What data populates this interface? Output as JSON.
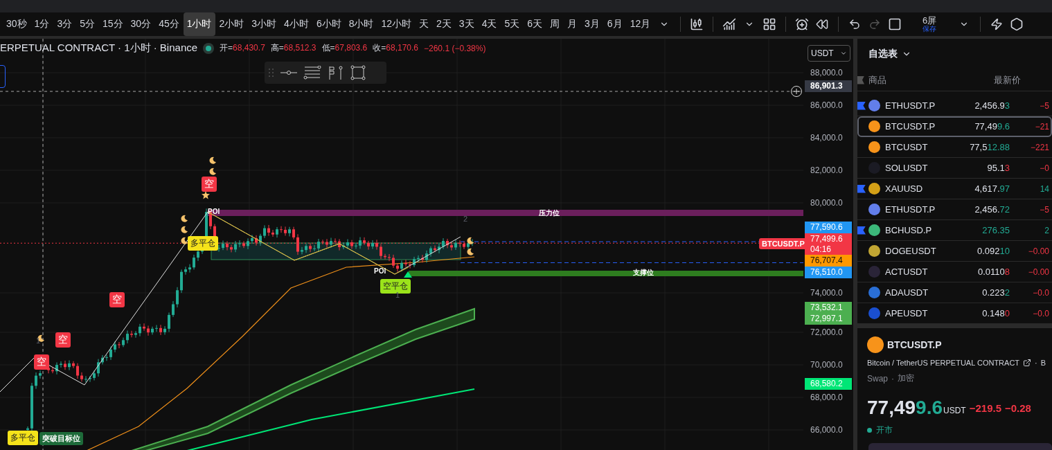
{
  "timeframes": [
    {
      "label": "30秒",
      "selected": false
    },
    {
      "label": "1分",
      "selected": false
    },
    {
      "label": "3分",
      "selected": false
    },
    {
      "label": "5分",
      "selected": false
    },
    {
      "label": "15分",
      "selected": false
    },
    {
      "label": "30分",
      "selected": false
    },
    {
      "label": "45分",
      "selected": false
    },
    {
      "label": "1小时",
      "selected": true
    },
    {
      "label": "2小时",
      "selected": false
    },
    {
      "label": "3小时",
      "selected": false
    },
    {
      "label": "4小时",
      "selected": false
    },
    {
      "label": "6小时",
      "selected": false
    },
    {
      "label": "8小时",
      "selected": false
    },
    {
      "label": "12小时",
      "selected": false
    },
    {
      "label": "天",
      "selected": false
    },
    {
      "label": "2天",
      "selected": false
    },
    {
      "label": "3天",
      "selected": false
    },
    {
      "label": "4天",
      "selected": false
    },
    {
      "label": "5天",
      "selected": false
    },
    {
      "label": "6天",
      "selected": false
    },
    {
      "label": "周",
      "selected": false
    },
    {
      "label": "月",
      "selected": false
    },
    {
      "label": "3月",
      "selected": false
    },
    {
      "label": "6月",
      "selected": false
    },
    {
      "label": "12月",
      "selected": false
    }
  ],
  "history": {
    "undo_disabled": false,
    "redo_disabled": true
  },
  "layout_button": {
    "label": "6屏",
    "sublabel": "保存"
  },
  "chart": {
    "title": "ERPETUAL CONTRACT · 1小时 · Binance",
    "ohlc": [
      {
        "label": "开=",
        "value": "68,430.7"
      },
      {
        "label": "高=",
        "value": "68,512.3"
      },
      {
        "label": "低=",
        "value": "67,803.6"
      },
      {
        "label": "收=",
        "value": "68,170.6"
      }
    ],
    "change": "−260.1 (−0.38%)",
    "currency": "USDT",
    "price_ticks": [
      "88,000.0",
      "86,000.0",
      "84,000.0",
      "82,000.0",
      "80,000.0",
      "74,000.0",
      "72,000.0",
      "70,000.0",
      "68,000.0",
      "66,000.0"
    ],
    "price_tags": [
      {
        "value": "86,901.3",
        "color": "#363a45"
      },
      {
        "value": "77,590.6",
        "color": "#2196f3"
      },
      {
        "value": "77,499.6",
        "sub": "04:16",
        "color": "#f23645"
      },
      {
        "value": "76,707.4",
        "color": "#ff9800"
      },
      {
        "value": "76,510.0",
        "color": "#2196f3"
      },
      {
        "value": "73,532.1",
        "color": "#4caf50"
      },
      {
        "value": "72,997.1",
        "color": "#4caf50"
      },
      {
        "value": "68,580.2",
        "color": "#00e676"
      }
    ],
    "markers": [
      {
        "kind": "short",
        "text": "空"
      },
      {
        "kind": "short",
        "text": "空"
      },
      {
        "kind": "short",
        "text": "空"
      },
      {
        "kind": "short",
        "text": "空"
      },
      {
        "kind": "close-long",
        "text": "多平仓"
      },
      {
        "kind": "close-long",
        "text": "多平仓"
      },
      {
        "kind": "close-short",
        "text": "空平仓"
      },
      {
        "kind": "poi",
        "text": "POI"
      },
      {
        "kind": "poi",
        "text": "POI"
      },
      {
        "kind": "level",
        "text": "压力位"
      },
      {
        "kind": "level",
        "text": "支撑位"
      },
      {
        "kind": "target",
        "text": "突破目标位"
      },
      {
        "kind": "count",
        "text": "1"
      },
      {
        "kind": "count",
        "text": "2"
      },
      {
        "kind": "count",
        "text": "1"
      },
      {
        "kind": "symbol",
        "text": "BTCUSDT.P"
      }
    ]
  },
  "watchlist": {
    "title": "自选表",
    "columns": [
      "商品",
      "最新价"
    ],
    "rows": [
      {
        "symbol": "ETHUSDT.P",
        "price": "2,456.9",
        "tail": "3",
        "tail_up": true,
        "change": "−5",
        "change_up": false,
        "flagged": true,
        "selected": false,
        "color": "#627eea"
      },
      {
        "symbol": "BTCUSDT.P",
        "price": "77,49",
        "tail": "9.6",
        "tail_up": true,
        "change": "−21",
        "change_up": false,
        "flagged": false,
        "selected": true,
        "color": "#f7931a"
      },
      {
        "symbol": "BTCUSDT",
        "price": "77,5",
        "tail": "12.88",
        "tail_up": true,
        "change": "−221",
        "change_up": false,
        "flagged": false,
        "selected": false,
        "color": "#f7931a"
      },
      {
        "symbol": "SOLUSDT",
        "price": "95.1",
        "tail": "3",
        "tail_up": false,
        "change": "−0",
        "change_up": false,
        "flagged": false,
        "selected": false,
        "color": "#1b1b24"
      },
      {
        "symbol": "XAUUSD",
        "price": "4,617.",
        "tail": "97",
        "tail_up": true,
        "change": "14",
        "change_up": true,
        "flagged": true,
        "selected": false,
        "color": "#d4a017"
      },
      {
        "symbol": "ETHUSDT.P",
        "price": "2,456.",
        "tail": "72",
        "tail_up": true,
        "change": "−5",
        "change_up": false,
        "flagged": false,
        "selected": false,
        "color": "#627eea"
      },
      {
        "symbol": "BCHUSD.P",
        "price": "",
        "tail": "276.35",
        "tail_up": true,
        "change": "2",
        "change_up": true,
        "flagged": true,
        "selected": false,
        "color": "#3cb87a"
      },
      {
        "symbol": "DOGEUSDT",
        "price": "0.092",
        "tail": "10",
        "tail_up": true,
        "change": "−0.00",
        "change_up": false,
        "flagged": false,
        "selected": false,
        "color": "#c2a633"
      },
      {
        "symbol": "ACTUSDT",
        "price": "0.0110",
        "tail": "8",
        "tail_up": false,
        "change": "−0.00",
        "change_up": false,
        "flagged": false,
        "selected": false,
        "color": "#2a2438"
      },
      {
        "symbol": "ADAUSDT",
        "price": "0.223",
        "tail": "2",
        "tail_up": true,
        "change": "−0.0",
        "change_up": false,
        "flagged": false,
        "selected": false,
        "color": "#2a6fd6"
      },
      {
        "symbol": "APEUSDT",
        "price": "0.148",
        "tail": "0",
        "tail_up": false,
        "change": "−0.0",
        "change_up": false,
        "flagged": false,
        "selected": false,
        "color": "#1a4fd0"
      }
    ]
  },
  "details": {
    "symbol": "BTCUSDT.P",
    "description": "Bitcoin / TetherUS PERPETUAL CONTRACT",
    "separator": "·",
    "exchange": "B",
    "type": "Swap",
    "category_separator": "·",
    "category": "加密",
    "price": "77,49",
    "price_tail": "9.6",
    "currency": "USDT",
    "change": "−219.5",
    "change_percent": "−0.28",
    "market_status": "开市",
    "market_open": true
  }
}
